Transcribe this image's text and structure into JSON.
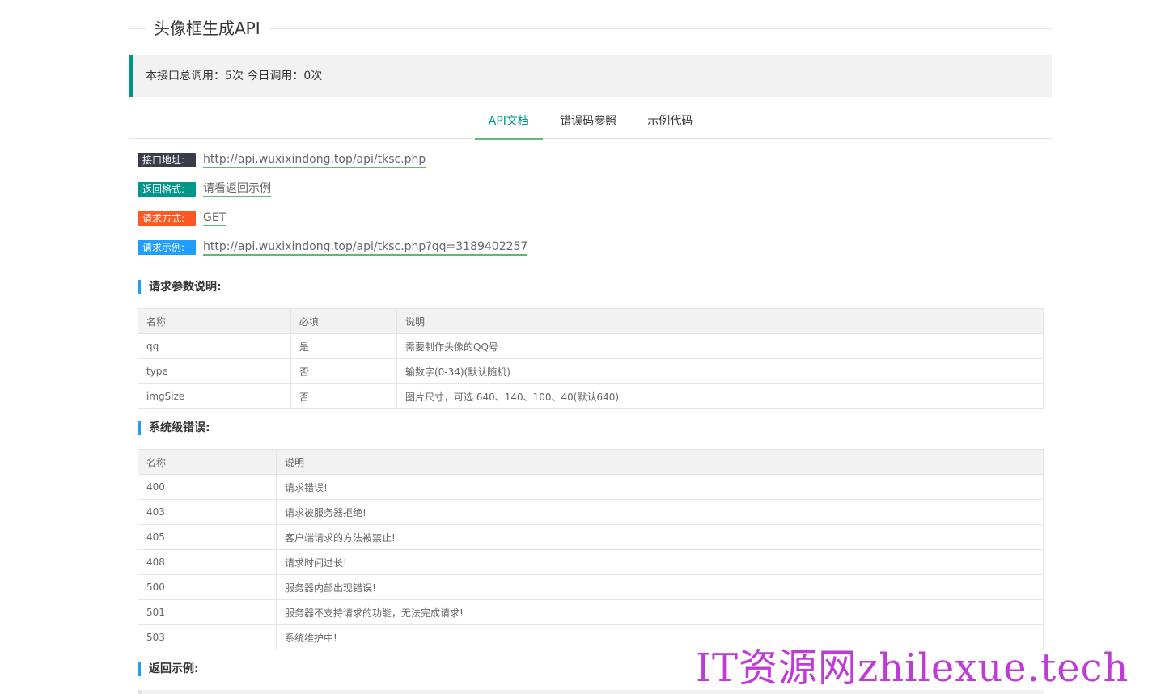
{
  "page_title": "头像框生成API",
  "stats_text": "本接口总调用：5次 今日调用：0次",
  "tabs": [
    {
      "label": "API文档",
      "active": true
    },
    {
      "label": "错误码参照",
      "active": false
    },
    {
      "label": "示例代码",
      "active": false
    }
  ],
  "info": {
    "address": {
      "label": "接口地址:",
      "value": "http://api.wuxixindong.top/api/tksc.php"
    },
    "format": {
      "label": "返回格式:",
      "value": "请看返回示例"
    },
    "method": {
      "label": "请求方式:",
      "value": "GET"
    },
    "example": {
      "label": "请求示例:",
      "value": "http://api.wuxixindong.top/api/tksc.php?qq=3189402257"
    }
  },
  "params_section": {
    "title": "请求参数说明:",
    "headers": [
      "名称",
      "必填",
      "说明"
    ],
    "rows": [
      [
        "qq",
        "是",
        "需要制作头像的QQ号"
      ],
      [
        "type",
        "否",
        "输数字(0-34)(默认随机)"
      ],
      [
        "imgSize",
        "否",
        "图片尺寸，可选 640、140、100、40(默认640)"
      ]
    ]
  },
  "errors_section": {
    "title": "系统级错误:",
    "headers": [
      "名称",
      "说明"
    ],
    "rows": [
      [
        "400",
        "请求错误!"
      ],
      [
        "403",
        "请求被服务器拒绝!"
      ],
      [
        "405",
        "客户端请求的方法被禁止!"
      ],
      [
        "408",
        "请求时间过长!"
      ],
      [
        "500",
        "服务器内部出现错误!"
      ],
      [
        "501",
        "服务器不支持请求的功能，无法完成请求!"
      ],
      [
        "503",
        "系统维护中!"
      ]
    ]
  },
  "return_section": {
    "title": "返回示例:"
  },
  "watermark": "IT资源网zhilexue.tech",
  "colors": {
    "accent": "#009688",
    "link_underline": "#5FB878",
    "section_bar": "#1E9FFF",
    "watermark": "#c03ad8"
  }
}
